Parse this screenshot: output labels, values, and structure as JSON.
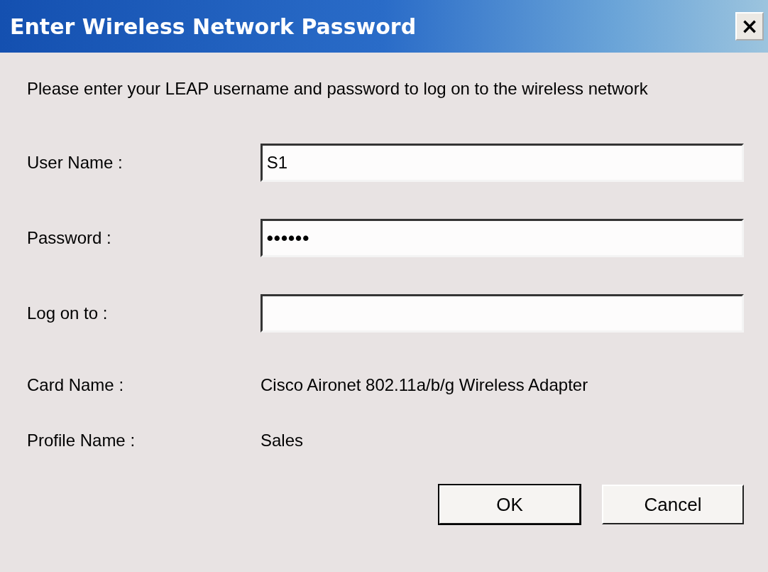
{
  "window": {
    "title": "Enter Wireless Network Password",
    "close": "×"
  },
  "message": "Please enter your LEAP username and password to log on to the wireless network",
  "fields": [
    {
      "label": "User Name :",
      "value": "S1",
      "kind": "text"
    },
    {
      "label": "Password :",
      "value": "••••••",
      "kind": "password"
    },
    {
      "label": "Log on to :",
      "kind": "text"
    }
  ],
  "info": [
    {
      "label": "Card Name :",
      "value": "Cisco Aironet 802.11a/b/g Wireless Adapter"
    },
    {
      "label": "Profile Name :",
      "value": "Sales"
    }
  ],
  "buttons": [
    {
      "label": "OK",
      "default": true
    },
    {
      "label": "Cancel",
      "default": false
    }
  ]
}
